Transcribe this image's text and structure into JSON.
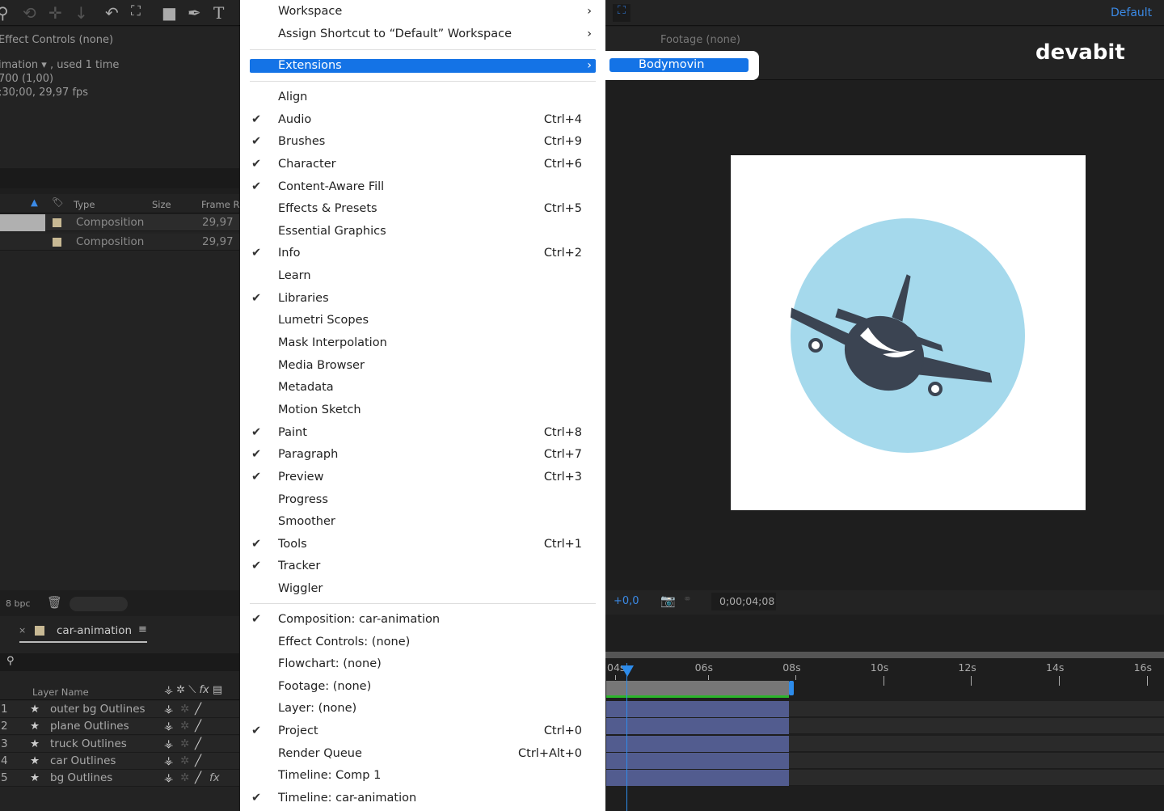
{
  "toolbar": {
    "workspace": "Default"
  },
  "effect_controls": {
    "title": "Effect Controls",
    "state": "(none)"
  },
  "project_info": {
    "line1": "imation",
    "used": ", used 1 time",
    "line2": "700 (1,00)",
    "line3": ";30;00, 29,97 fps"
  },
  "project_table": {
    "columns": [
      "Type",
      "Size",
      "Frame R..."
    ],
    "rows": [
      {
        "type": "Composition",
        "fps": "29,97"
      },
      {
        "type": "Composition",
        "fps": "29,97"
      }
    ],
    "bpc": "8 bpc"
  },
  "timeline": {
    "tab": "car-animation",
    "col_layer_name": "Layer Name",
    "layers": [
      {
        "num": "1",
        "name": "outer bg Outlines"
      },
      {
        "num": "2",
        "name": "plane Outlines"
      },
      {
        "num": "3",
        "name": "truck Outlines"
      },
      {
        "num": "4",
        "name": "car Outlines"
      },
      {
        "num": "5",
        "name": "bg Outlines",
        "fx": "fx"
      }
    ],
    "ticks": [
      "04s",
      "06s",
      "08s",
      "10s",
      "12s",
      "14s",
      "16s"
    ],
    "offset": "+0,0",
    "timecode": "0;00;04;08"
  },
  "viewer": {
    "footage": "Footage",
    "footage_state": "(none)",
    "watermark": "devabit"
  },
  "menu": {
    "items": [
      {
        "label": "Workspace",
        "submenu": true
      },
      {
        "label": "Assign Shortcut to “Default” Workspace",
        "submenu": true
      },
      {
        "label": "Extensions",
        "submenu": true,
        "highlighted": true
      },
      {
        "label": "Align"
      },
      {
        "label": "Audio",
        "checked": true,
        "shortcut": "Ctrl+4"
      },
      {
        "label": "Brushes",
        "checked": true,
        "shortcut": "Ctrl+9"
      },
      {
        "label": "Character",
        "checked": true,
        "shortcut": "Ctrl+6"
      },
      {
        "label": "Content-Aware Fill",
        "checked": true
      },
      {
        "label": "Effects & Presets",
        "shortcut": "Ctrl+5"
      },
      {
        "label": "Essential Graphics"
      },
      {
        "label": "Info",
        "checked": true,
        "shortcut": "Ctrl+2"
      },
      {
        "label": "Learn"
      },
      {
        "label": "Libraries",
        "checked": true
      },
      {
        "label": "Lumetri Scopes"
      },
      {
        "label": "Mask Interpolation"
      },
      {
        "label": "Media Browser"
      },
      {
        "label": "Metadata"
      },
      {
        "label": "Motion Sketch"
      },
      {
        "label": "Paint",
        "checked": true,
        "shortcut": "Ctrl+8"
      },
      {
        "label": "Paragraph",
        "checked": true,
        "shortcut": "Ctrl+7"
      },
      {
        "label": "Preview",
        "checked": true,
        "shortcut": "Ctrl+3"
      },
      {
        "label": "Progress"
      },
      {
        "label": "Smoother"
      },
      {
        "label": "Tools",
        "checked": true,
        "shortcut": "Ctrl+1"
      },
      {
        "label": "Tracker",
        "checked": true
      },
      {
        "label": "Wiggler"
      },
      {
        "label": "Composition: car-animation",
        "checked": true
      },
      {
        "label": "Effect Controls: (none)"
      },
      {
        "label": "Flowchart: (none)"
      },
      {
        "label": "Footage: (none)"
      },
      {
        "label": "Layer: (none)"
      },
      {
        "label": "Project",
        "checked": true,
        "shortcut": "Ctrl+0"
      },
      {
        "label": "Render Queue",
        "shortcut": "Ctrl+Alt+0"
      },
      {
        "label": "Timeline: Comp 1"
      },
      {
        "label": "Timeline: car-animation",
        "checked": true
      }
    ],
    "check_glyph": "✔",
    "arrow_glyph": "›"
  },
  "submenu": {
    "items": [
      "Bodymovin"
    ]
  },
  "colors": {
    "accent": "#1473e6",
    "layer_bar": "#525c8f",
    "work_area": "#2bb52b",
    "circle": "#a5d9ec",
    "plane": "#3b4452"
  }
}
